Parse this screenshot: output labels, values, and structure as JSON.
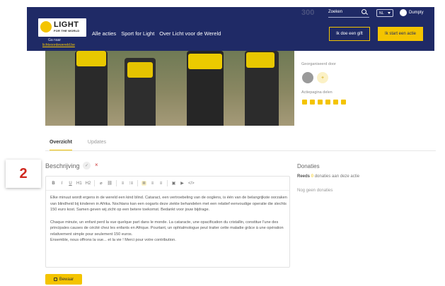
{
  "header": {
    "logo": {
      "title": "LIGHT",
      "subtitle": "FOR THE WORLD"
    },
    "goto_label": "Ga naar",
    "goto_link": "lichtvoordewereld.be",
    "nav": [
      "Alle acties",
      "Sport for Light",
      "Over Licht voor de Wereld"
    ],
    "faded_number": "300",
    "search": {
      "label": "Zoeken"
    },
    "language": "NL",
    "user": "Dumpty",
    "gift_button": "Ik doe een gift",
    "start_button": "Ik start een actie"
  },
  "sidebar": {
    "organized_label": "Georganiseerd door",
    "add_symbol": "+",
    "share_label": "Actiepagina delen",
    "share_icons": [
      "facebook-icon",
      "whatsapp-icon",
      "twitter-icon",
      "linkedin-icon",
      "mail-icon",
      "link-icon"
    ]
  },
  "tabs": [
    "Overzicht",
    "Updates"
  ],
  "badge": "2",
  "description": {
    "title": "Beschrijving",
    "check": "✓",
    "close": "×",
    "toolbar": [
      "B",
      "I",
      "U",
      "H1",
      "H2",
      "⌀",
      "⛓",
      "≡",
      "⁝≡",
      "≣",
      "≡",
      "≡",
      "▣",
      "▶",
      "</>"
    ],
    "paragraph1": "Elke minuut wordt ergens in de wereld een kind blind. Cataract, een vertroebeling van de ooglens, is één van de belangrijkste oorzaken van blindheid bij kinderen in Afrika. Nochtans kan een oogarts deze ziekte behandelen met een relatief eenvoudige operatie die slechts 150 euro kost. Samen geven wij zicht op een betere toekomst. Bedankt voor jouw bijdrage.",
    "paragraph2": "Chaque minute, un enfant perd la vue quelque part dans le monde. La cataracte, une opacification du cristallin, constitue l'une des principales causes de cécité chez les enfants en Afrique. Pourtant, un ophtalmologue peut traiter cette maladie grâce à une opération relativement simple pour seulement 150 euros.",
    "paragraph3": "Ensemble, nous offrons la vue... et la vie ! Merci pour votre contribution."
  },
  "save_button": "Bewaar",
  "donations": {
    "title": "Donaties",
    "prefix": "Reeds",
    "count": "0",
    "suffix": "donaties aan deze actie",
    "none": "Nog geen donaties"
  }
}
